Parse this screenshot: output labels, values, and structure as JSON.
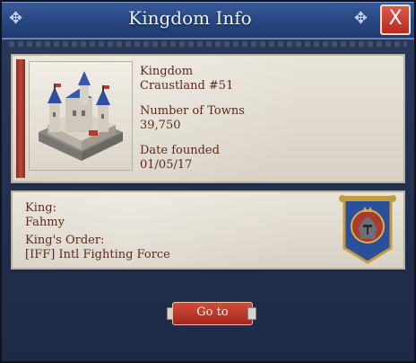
{
  "title": "Kingdom Info",
  "close_label": "X",
  "kingdom": {
    "kingdom_label": "Kingdom",
    "kingdom_value": "Craustland #51",
    "towns_label": "Number of Towns",
    "towns_value": "39,750",
    "date_label": "Date founded",
    "date_value": "01/05/17"
  },
  "king": {
    "king_label": "King:",
    "king_value": "Fahmy",
    "order_label": "King's Order:",
    "order_value": "[IFF] Intl Fighting Force"
  },
  "goto_label": "Go to",
  "colors": {
    "title_bar": "#2a4a86",
    "parchment": "#e2ddd2",
    "text": "#5a2a1e",
    "button": "#b8362a"
  }
}
